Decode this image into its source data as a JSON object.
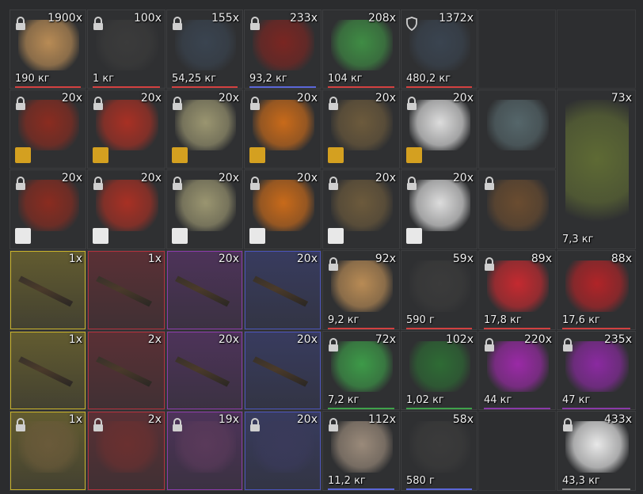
{
  "colors": {
    "bar_red": "#d24040",
    "bar_blue": "#5a66d8",
    "bar_green": "#3fa24a",
    "rarity_yellow": "#c8b22a",
    "rarity_red": "#b0303c",
    "rarity_purple": "#8a3aa8",
    "rarity_blue": "#4a52b8"
  },
  "inventory": [
    {
      "qty": "1900x",
      "weight": "190 кг",
      "icon": "orange-tape-box-icon",
      "art": "#b88b55",
      "bar": "#d24040",
      "lock": true
    },
    {
      "qty": "100x",
      "weight": "1 кг",
      "icon": "black-orange-case-icon",
      "art": "#3b3b3b",
      "bar": "#d24040",
      "lock": true
    },
    {
      "qty": "155x",
      "weight": "54,25 кг",
      "icon": "electronic-device-icon",
      "art": "#3a4450",
      "bar": "#d24040",
      "lock": true
    },
    {
      "qty": "233x",
      "weight": "93,2 кг",
      "icon": "food-can-icon",
      "art": "#7a2622",
      "bar": "#5a66d8",
      "lock": true
    },
    {
      "qty": "208x",
      "weight": "104 кг",
      "icon": "green-bottle-icon",
      "art": "#3f8c44",
      "bar": "#d24040",
      "lock": false
    },
    {
      "qty": "1372x",
      "weight": "480,2 кг",
      "icon": "electronic-device-icon",
      "art": "#3a4450",
      "bar": "#d24040",
      "lock": true,
      "shield": true
    },
    {
      "empty": true
    },
    {
      "empty": true
    },
    {
      "qty": "20x",
      "icon": "red-camo-skin-icon",
      "art": "#8a2c20",
      "badge": true,
      "lock": true
    },
    {
      "qty": "20x",
      "icon": "red-cyan-skin-icon",
      "art": "#a83024",
      "badge": true,
      "lock": true
    },
    {
      "qty": "20x",
      "icon": "tan-camo-skin-icon",
      "art": "#9a9570",
      "badge": true,
      "lock": true
    },
    {
      "qty": "20x",
      "icon": "orange-camo-skin-icon",
      "art": "#c86a1a",
      "badge": true,
      "lock": true
    },
    {
      "qty": "20x",
      "icon": "brown-camo-skin-icon",
      "art": "#6c5a3c",
      "badge": true,
      "lock": true
    },
    {
      "qty": "20x",
      "icon": "pumpkin-skin-icon",
      "art": "#dcdcdc",
      "badge": true,
      "lock": true
    },
    {
      "icon": "zombie-face-icon",
      "art": "#55666a",
      "lock": false
    },
    {
      "qty": "73x",
      "weight": "7,3 кг",
      "icon": "champagne-bottle-icon",
      "art": "#5e6a34",
      "tall": true,
      "lock": false
    },
    {
      "qty": "20x",
      "icon": "red-camo-vest-icon",
      "art": "#8a2c20",
      "badge": true,
      "lock": true
    },
    {
      "qty": "20x",
      "icon": "red-cyan-vest-icon",
      "art": "#a83024",
      "badge": true,
      "lock": true
    },
    {
      "qty": "20x",
      "icon": "tan-camo-vest-icon",
      "art": "#9a9570",
      "badge": true,
      "lock": true
    },
    {
      "qty": "20x",
      "icon": "orange-camo-vest-icon",
      "art": "#c86a1a",
      "badge": true,
      "lock": true
    },
    {
      "qty": "20x",
      "icon": "brown-camo-vest-icon",
      "art": "#6c5a3c",
      "badge": true,
      "lock": true
    },
    {
      "qty": "20x",
      "icon": "pumpkin-vest-icon",
      "art": "#dcdcdc",
      "badge": true,
      "lock": true
    },
    {
      "icon": "burlap-mask-icon",
      "art": "#6a4c30",
      "lock": true
    },
    {
      "qty": "1x",
      "icon": "assault-rifle-icon",
      "rarity": "#c8b22a",
      "lock": false
    },
    {
      "qty": "1x",
      "icon": "assault-rifle-icon",
      "rarity": "#b0303c",
      "lock": false
    },
    {
      "qty": "20x",
      "icon": "assault-rifle-icon",
      "rarity": "#8a3aa8",
      "lock": false
    },
    {
      "qty": "20x",
      "icon": "assault-rifle-icon",
      "rarity": "#4a52b8",
      "lock": false
    },
    {
      "qty": "92x",
      "weight": "9,2 кг",
      "icon": "orange-tape-box-icon",
      "art": "#b88b55",
      "bar": "#d24040",
      "lock": true
    },
    {
      "qty": "59x",
      "weight": "590 г",
      "icon": "black-orange-case-icon",
      "art": "#3b3b3b",
      "bar": "#d24040",
      "lock": false
    },
    {
      "qty": "89x",
      "weight": "17,8 кг",
      "icon": "red-toolbox-icon",
      "art": "#c42a30",
      "bar": "#d24040",
      "lock": true
    },
    {
      "qty": "88x",
      "weight": "17,6 кг",
      "icon": "red-weapon-case-icon",
      "art": "#b02428",
      "bar": "#d24040",
      "lock": false
    },
    {
      "qty": "1x",
      "icon": "shotgun-icon",
      "rarity": "#c8b22a",
      "lock": false
    },
    {
      "qty": "2x",
      "icon": "shotgun-icon",
      "rarity": "#b0303c",
      "lock": false
    },
    {
      "qty": "20x",
      "icon": "shotgun-icon",
      "rarity": "#8a3aa8",
      "lock": false
    },
    {
      "qty": "20x",
      "icon": "shotgun-icon",
      "rarity": "#4a52b8",
      "lock": false
    },
    {
      "qty": "72x",
      "weight": "7,2 кг",
      "icon": "green-tape-box-icon",
      "art": "#3d9a48",
      "bar": "#3fa24a",
      "lock": true
    },
    {
      "qty": "102x",
      "weight": "1,02 кг",
      "icon": "green-case-icon",
      "art": "#2e6b34",
      "bar": "#3fa24a",
      "lock": false
    },
    {
      "qty": "220x",
      "weight": "44 кг",
      "icon": "purple-toolbox-icon",
      "art": "#9a2aa6",
      "bar": "#8a3aa8",
      "lock": true
    },
    {
      "qty": "235x",
      "weight": "47 кг",
      "icon": "purple-weapon-case-icon",
      "art": "#8a2aa0",
      "bar": "#8a3aa8",
      "lock": true
    },
    {
      "qty": "1x",
      "icon": "armored-suit-icon",
      "rarity": "#c8b22a",
      "art": "#6a5a3a",
      "lock": true
    },
    {
      "qty": "2x",
      "icon": "armored-suit-icon",
      "rarity": "#b0303c",
      "art": "#6a3030",
      "lock": true
    },
    {
      "qty": "19x",
      "icon": "armored-suit-icon",
      "rarity": "#8a3aa8",
      "art": "#5a3a5a",
      "lock": true
    },
    {
      "qty": "20x",
      "icon": "armored-suit-icon",
      "rarity": "#4a52b8",
      "art": "#3a3a5a",
      "lock": true
    },
    {
      "qty": "112x",
      "weight": "11,2 кг",
      "icon": "gray-tape-box-icon",
      "art": "#9a8a7a",
      "bar": "#5a66d8",
      "lock": true
    },
    {
      "qty": "58x",
      "weight": "580 г",
      "icon": "black-orange-case-icon",
      "art": "#3b3b3b",
      "bar": "#5a66d8",
      "lock": false
    },
    {
      "empty": true
    },
    {
      "qty": "433x",
      "weight": "43,3 кг",
      "icon": "white-orb-icon",
      "art": "#e8e8e8",
      "bar": "#8a8a8a",
      "lock": true
    }
  ]
}
